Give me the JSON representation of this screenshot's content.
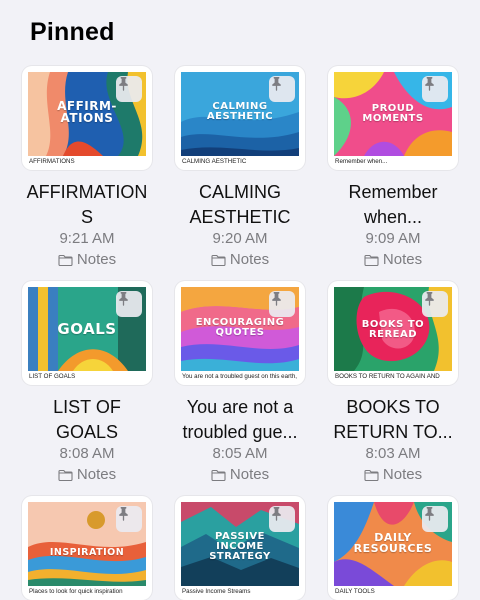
{
  "header": {
    "title": "Pinned"
  },
  "colors": {
    "background": "#f2f2f7",
    "secondary_text": "#7c7c80"
  },
  "notes": [
    {
      "thumb_text": "AFFIRM-\nATIONS",
      "caption": "AFFIRMATIONS",
      "title": "AFFIRMATION\nS",
      "time": "9:21 AM",
      "folder": "Notes",
      "pin_icon": "pin-icon",
      "folder_icon": "folder-icon"
    },
    {
      "thumb_text": "CALMING\nAESTHETIC",
      "caption": "CALMING AESTHETIC",
      "title": "CALMING\nAESTHETIC",
      "time": "9:20 AM",
      "folder": "Notes",
      "pin_icon": "pin-icon",
      "folder_icon": "folder-icon"
    },
    {
      "thumb_text": "PROUD\nMOMENTS",
      "caption": "Remember when...",
      "title": "Remember\nwhen...",
      "time": "9:09 AM",
      "folder": "Notes",
      "pin_icon": "pin-icon",
      "folder_icon": "folder-icon"
    },
    {
      "thumb_text": "GOALS",
      "caption": "LIST OF GOALS",
      "title": "LIST OF\nGOALS",
      "time": "8:08 AM",
      "folder": "Notes",
      "pin_icon": "pin-icon",
      "folder_icon": "folder-icon"
    },
    {
      "thumb_text": "ENCOURAGING\nQUOTES",
      "caption": "You are not a troubled guest on this earth,",
      "title": "You are not a\ntroubled gue...",
      "time": "8:05 AM",
      "folder": "Notes",
      "pin_icon": "pin-icon",
      "folder_icon": "folder-icon"
    },
    {
      "thumb_text": "BOOKS TO\nREREAD",
      "caption": "BOOKS TO RETURN TO AGAIN AND",
      "title": "BOOKS TO\nRETURN TO...",
      "time": "8:03 AM",
      "folder": "Notes",
      "pin_icon": "pin-icon",
      "folder_icon": "folder-icon"
    },
    {
      "thumb_text": "INSPIRATION",
      "caption": "Places to look for quick inspiration",
      "title": "",
      "time": "",
      "folder": "",
      "pin_icon": "pin-icon",
      "folder_icon": "folder-icon"
    },
    {
      "thumb_text": "PASSIVE\nINCOME\nSTRATEGY",
      "caption": "Passive Income Streams",
      "title": "",
      "time": "",
      "folder": "",
      "pin_icon": "pin-icon",
      "folder_icon": "folder-icon"
    },
    {
      "thumb_text": "DAILY\nRESOURCES",
      "caption": "DAILY TOOLS",
      "title": "",
      "time": "",
      "folder": "",
      "pin_icon": "pin-icon",
      "folder_icon": "folder-icon"
    }
  ]
}
